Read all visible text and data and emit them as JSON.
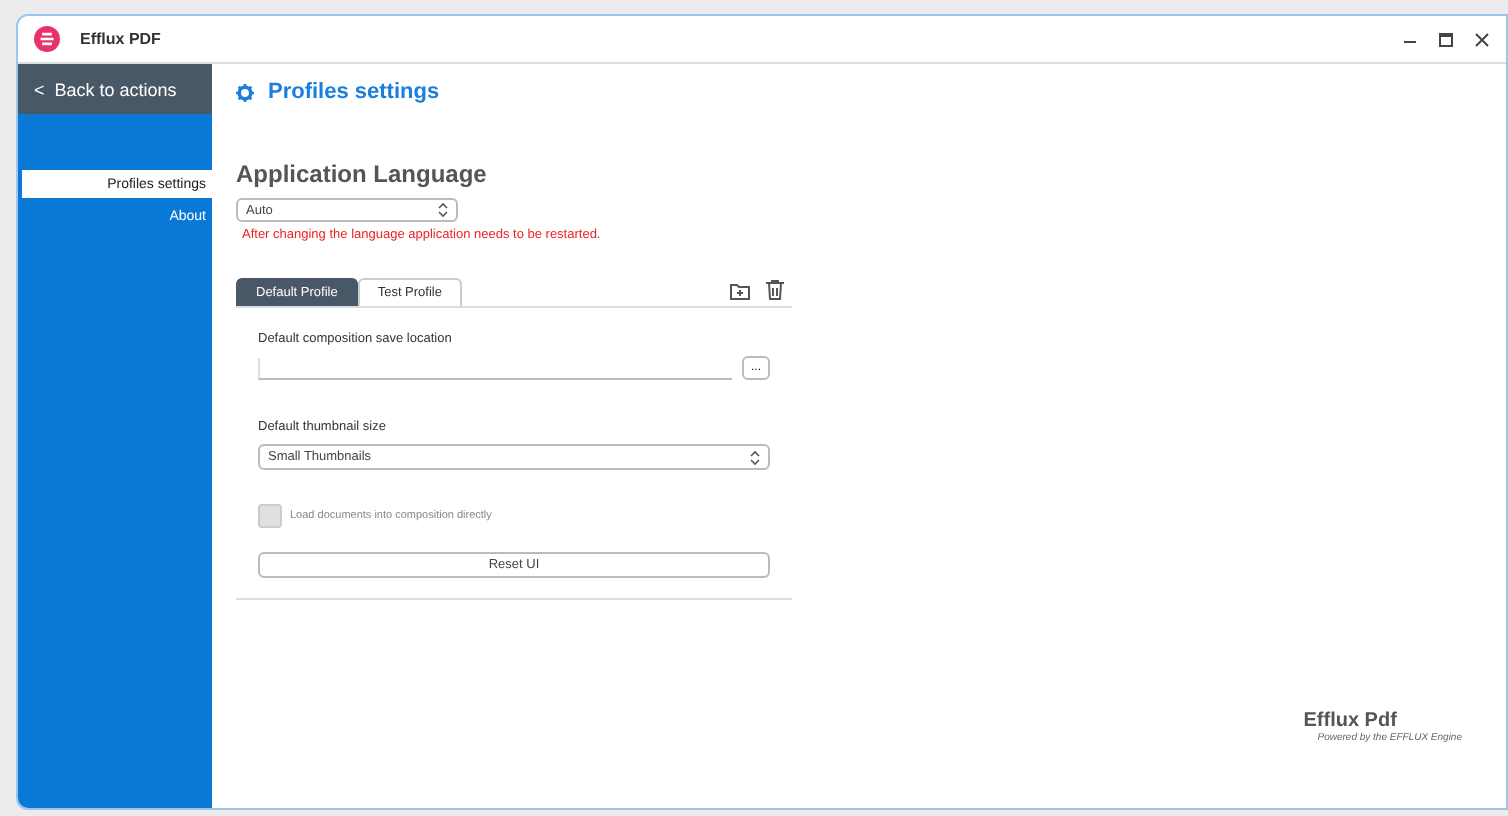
{
  "window": {
    "title": "Efflux PDF"
  },
  "sidebar": {
    "back": "Back to actions",
    "back_chevron": "<",
    "items": [
      {
        "label": "Profiles settings",
        "selected": true
      },
      {
        "label": "About",
        "selected": false
      }
    ]
  },
  "page": {
    "title": "Profiles settings"
  },
  "language": {
    "heading": "Application Language",
    "value": "Auto",
    "warning": "After changing the language application needs to be restarted."
  },
  "tabs": [
    {
      "label": "Default Profile",
      "selected": true
    },
    {
      "label": "Test Profile",
      "selected": false
    }
  ],
  "profile": {
    "save_location_label": "Default composition save location",
    "browse": "...",
    "thumbnail_label": "Default thumbnail size",
    "thumbnail_value": "Small Thumbnails",
    "load_directly": {
      "label": "Load documents into composition directly",
      "checked": false,
      "disabled": true
    },
    "reset": "Reset UI"
  },
  "footer": {
    "brand": "Efflux Pdf",
    "tagline": "Powered by the EFFLUX Engine"
  }
}
